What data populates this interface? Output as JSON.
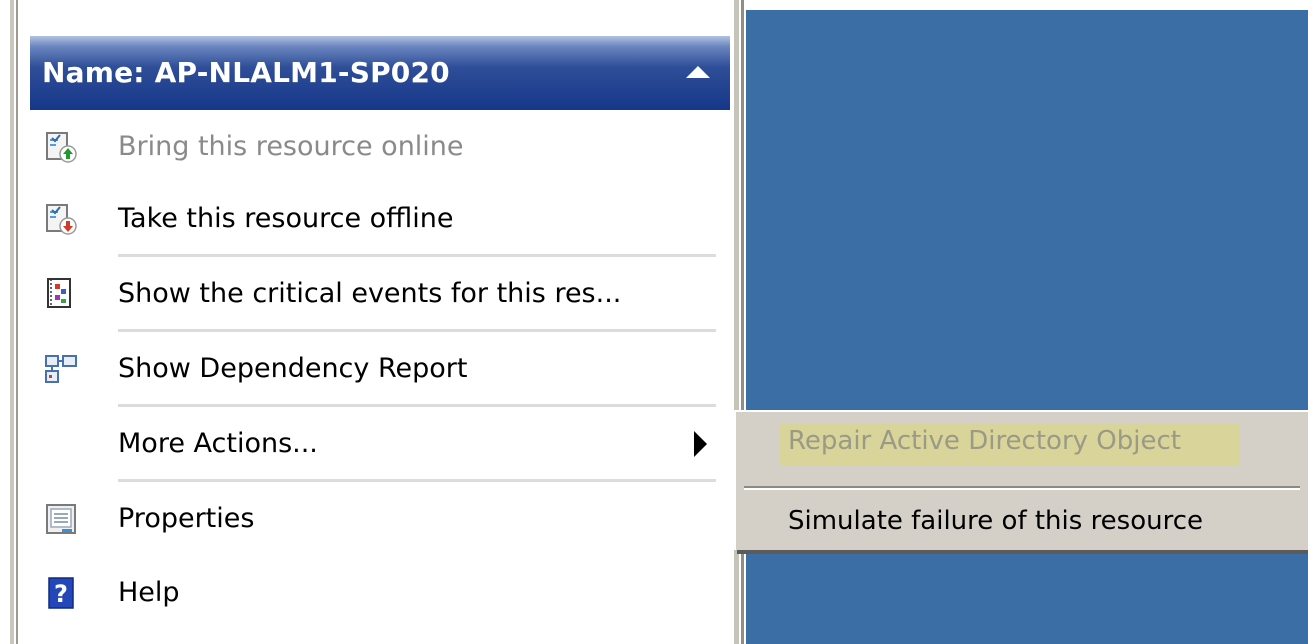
{
  "actions_pane": {
    "header_title": "Name: AP-NLALM1-SP020",
    "items": [
      {
        "label": "Bring this resource online",
        "icon": "bring-online-icon",
        "disabled": true
      },
      {
        "label": "Take this resource offline",
        "icon": "take-offline-icon",
        "disabled": false
      },
      {
        "label": "Show the critical events for this res...",
        "icon": "critical-events-icon",
        "disabled": false
      },
      {
        "label": "Show Dependency Report",
        "icon": "dependency-report-icon",
        "disabled": false
      },
      {
        "label": "More Actions...",
        "icon": "",
        "disabled": false
      },
      {
        "label": "Properties",
        "icon": "properties-icon",
        "disabled": false
      },
      {
        "label": "Help",
        "icon": "help-icon",
        "disabled": false
      }
    ]
  },
  "context_menu": {
    "items": [
      {
        "label": "Repair Active Directory Object",
        "disabled": true,
        "highlighted": true
      },
      {
        "label": "Simulate failure of this resource",
        "disabled": false,
        "highlighted": false
      }
    ]
  },
  "colors": {
    "header_gradient_top": "#b2c2e2",
    "header_gradient_bottom": "#16378a",
    "desktop_blue": "#3a6ea5",
    "menu_background": "#d4d0c8",
    "highlight": "#d8d49a"
  }
}
